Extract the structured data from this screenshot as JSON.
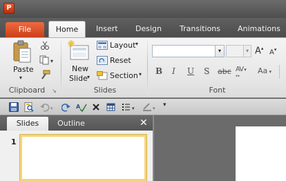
{
  "app": {
    "icon_letter": "P"
  },
  "tabs": [
    {
      "label": "File"
    },
    {
      "label": "Home"
    },
    {
      "label": "Insert"
    },
    {
      "label": "Design"
    },
    {
      "label": "Transitions"
    },
    {
      "label": "Animations"
    }
  ],
  "ribbon": {
    "clipboard": {
      "label": "Clipboard",
      "paste_label": "Paste"
    },
    "slides": {
      "label": "Slides",
      "new_slide_line1": "New",
      "new_slide_line2": "Slide",
      "layout_label": "Layout",
      "reset_label": "Reset",
      "section_label": "Section"
    },
    "font": {
      "label": "Font",
      "font_name_value": "",
      "font_size_value": "",
      "grow_label": "A",
      "shrink_label": "A",
      "bold": "B",
      "italic": "I",
      "underline": "U",
      "shadow": "S",
      "strike": "abc",
      "spacing": "AV",
      "case": "Aa"
    }
  },
  "pane": {
    "tab_slides": "Slides",
    "tab_outline": "Outline",
    "close_glyph": "✕",
    "slide_number": "1"
  },
  "colors": {
    "file_tab": "#d0481f",
    "selected_thumb_border": "#f3d67b",
    "app_icon": "#c8421c"
  },
  "icons": [
    "powerpoint-app-icon",
    "paste-icon",
    "cut-icon",
    "copy-icon",
    "format-painter-icon",
    "new-slide-icon",
    "layout-icon",
    "reset-icon",
    "section-icon",
    "save-icon",
    "print-preview-icon",
    "undo-icon",
    "redo-icon",
    "spelling-icon",
    "delete-icon",
    "table-icon",
    "bullets-icon",
    "pen-color-icon",
    "qat-customize-icon"
  ]
}
